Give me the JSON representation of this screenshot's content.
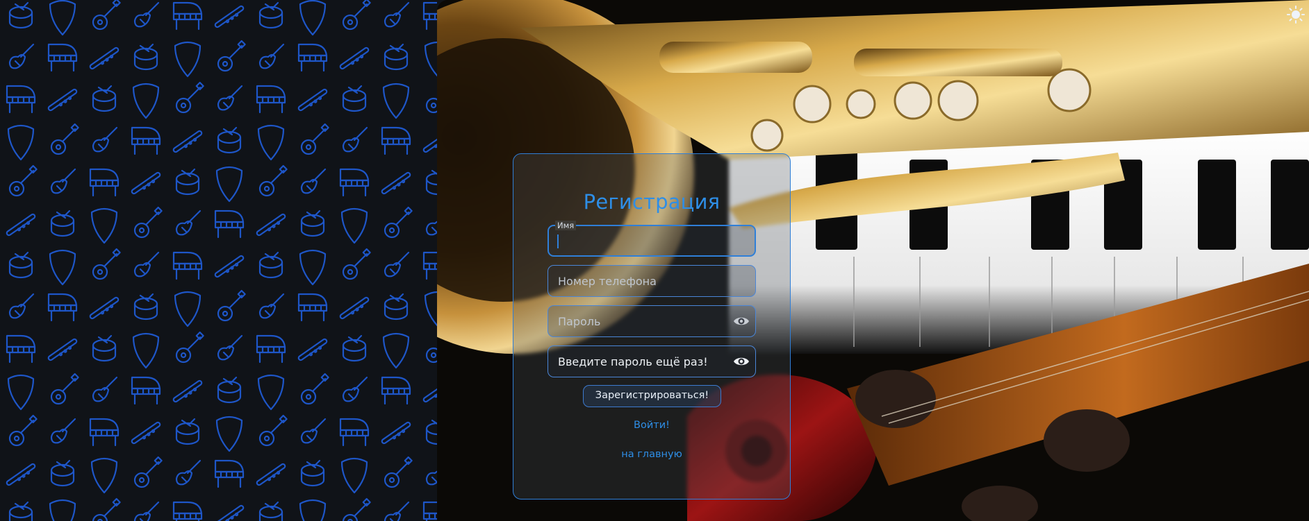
{
  "form": {
    "title": "Регистрация",
    "name_label": "Имя",
    "name_value": "",
    "phone_placeholder": "Номер телефона",
    "password_placeholder": "Пароль",
    "password_repeat_placeholder": "Введите пароль ещё раз!",
    "submit_label": "Зарегистрироваться!",
    "login_link": "Войти!",
    "home_link": "на главную"
  },
  "icons": {
    "theme_toggle": "sun-icon",
    "password_visibility": "eye-icon",
    "pattern": [
      "drum-icon",
      "guitar-pick-icon",
      "acoustic-guitar-icon",
      "electric-guitar-icon",
      "grand-piano-icon",
      "flute-icon"
    ]
  },
  "colors": {
    "accent": "#2e8ee6",
    "border": "#2f7fd8",
    "pattern_icon": "#1e56c8",
    "page_background": "#101318"
  }
}
